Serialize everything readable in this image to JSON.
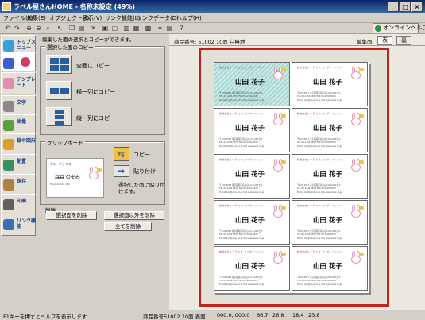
{
  "window": {
    "title": "ラベル屋さんHOME - 名称未設定 (49%)",
    "min": "_",
    "max": "□",
    "close": "×"
  },
  "menu": [
    "ファイル(F)",
    "編集(E)",
    "オブジェクト(O)",
    "表示(V)",
    "リンク機能(L)",
    "リンクデータ(D)",
    "ヘルプ(H)"
  ],
  "toolbar": {
    "online_help": "オンラインヘルプ"
  },
  "sidebar": [
    {
      "label": "トップメニュー",
      "color": "#3aa0d8"
    },
    {
      "label": "",
      "color": "#3a60c8"
    },
    {
      "label": "テンプレート",
      "color": "#e08fb0"
    },
    {
      "label": "文字",
      "color": "#8a8a8a"
    },
    {
      "label": "画像",
      "color": "#5aa040"
    },
    {
      "label": "線や図形",
      "color": "#d9a030"
    },
    {
      "label": "配置",
      "color": "#3a9060"
    },
    {
      "label": "保存",
      "color": "#b08040"
    },
    {
      "label": "印刷",
      "color": "#606060"
    },
    {
      "label": "リンク機能",
      "color": "#3a70b0"
    }
  ],
  "panel": {
    "header": "編集した面の選択とコピーができます。",
    "copy_box": "選択した面のコピー",
    "copy_all": "全面にコピー",
    "copy_row": "横一列にコピー",
    "copy_col": "縦一列にコピー",
    "clip_box": "クリップボード",
    "copy_btn": "コピー",
    "paste_btn": "貼り付け",
    "paste_sel": "選択した面に貼り付けます。",
    "delete_box": "削除",
    "del_sel": "選択面を削除",
    "del_other": "選択面以外を削除",
    "del_all": "全てを削除",
    "clip_company": "Aコーポラウス",
    "clip_name": "森森 のぞみ",
    "clip_sub": "Taiyo-Kohito ABC"
  },
  "canvas": {
    "product": "商品番号: 51002 10面 白無地",
    "edit_label": "編集面",
    "front": "表",
    "back": "裏",
    "card": {
      "company": "株式会社ルーラ ミス コーポレーション",
      "name": "山田 花子",
      "addr1": "〒123-4567 東京都港区南青山0-0-0 ABCビル",
      "addr2": "TEL 03-1234-5678  FAX 03-1234-5679",
      "addr3": "E-mail xxx@xxxx.co.jp  URL www.xxxx.co.jp"
    }
  },
  "status": {
    "hint": "F1キーを押すとヘルプを表示します",
    "product": "商品番号51002 10面 表面",
    "coords": "000.0, 000.0",
    "w": "66.7",
    "h": "26.8",
    "x": "18.4",
    "y": "23.8"
  }
}
